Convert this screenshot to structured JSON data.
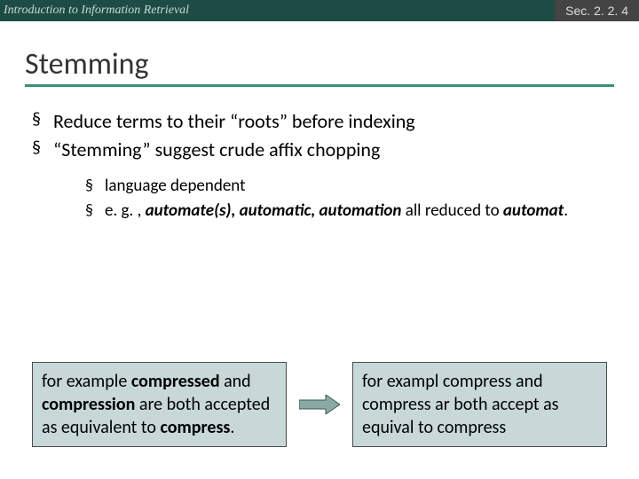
{
  "header": {
    "course": "Introduction to Information Retrieval",
    "section": "Sec. 2. 2. 4"
  },
  "title": "Stemming",
  "bullets": {
    "b1": "Reduce terms to their “roots” before indexing",
    "b2": "“Stemming” suggest crude affix chopping",
    "b2a": "language dependent",
    "b2b_pre": "e. g. , ",
    "b2b_em": "automate(s), automatic, automation",
    "b2b_mid": " all reduced to ",
    "b2b_em2": "automat",
    "b2b_post": "."
  },
  "example": {
    "left_pre": "for example ",
    "left_b1": "compressed",
    "left_mid1": " and ",
    "left_b2": "compression",
    "left_mid2": " are both accepted as equivalent to ",
    "left_b3": "compress",
    "left_post": ".",
    "right": "for exampl compress and compress ar both accept as equival to compress"
  }
}
